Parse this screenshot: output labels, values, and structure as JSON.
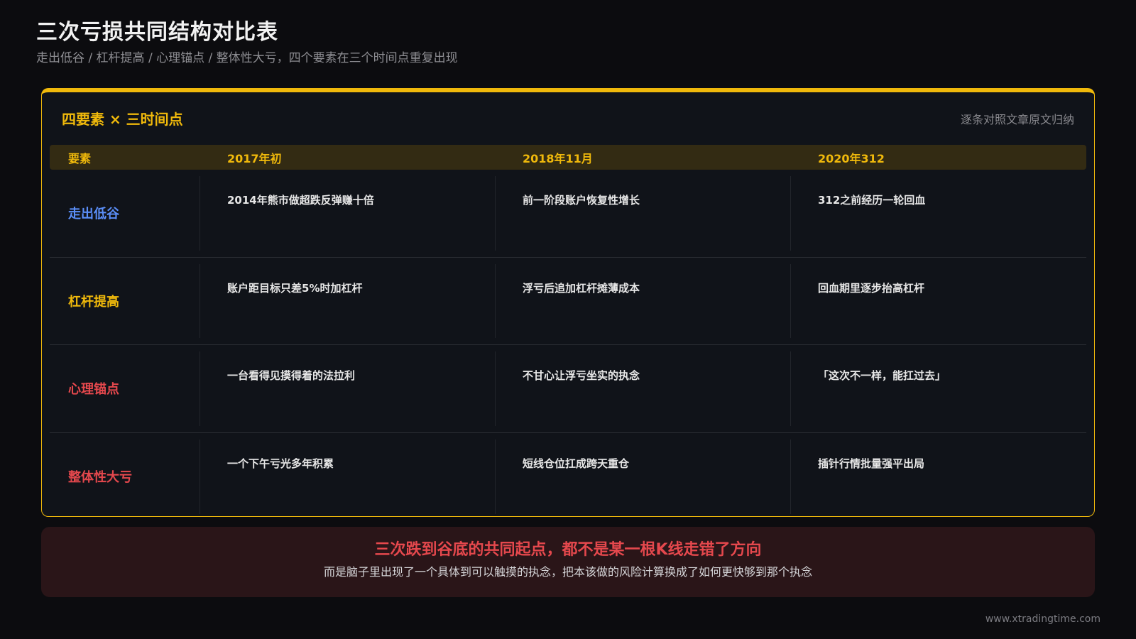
{
  "header": {
    "title": "三次亏损共同结构对比表",
    "subtitle": "走出低谷 / 杠杆提高 / 心理锚点 / 整体性大亏，四个要素在三个时间点重复出现"
  },
  "card": {
    "title": "四要素 × 三时间点",
    "note": "逐条对照文章原文归纳",
    "columns": [
      "要素",
      "2017年初",
      "2018年11月",
      "2020年312"
    ],
    "rows": [
      {
        "label": "走出低谷",
        "color": "#5b8ff9",
        "cells": [
          "2014年熊市做超跌反弹赚十倍",
          "前一阶段账户恢复性增长",
          "312之前经历一轮回血"
        ]
      },
      {
        "label": "杠杆提高",
        "color": "#f0b90b",
        "cells": [
          "账户距目标只差5%时加杠杆",
          "浮亏后追加杠杆摊薄成本",
          "回血期里逐步抬高杠杆"
        ]
      },
      {
        "label": "心理锚点",
        "color": "#e5484d",
        "cells": [
          "一台看得见摸得着的法拉利",
          "不甘心让浮亏坐实的执念",
          "「这次不一样，能扛过去」"
        ]
      },
      {
        "label": "整体性大亏",
        "color": "#e5484d",
        "cells": [
          "一个下午亏光多年积累",
          "短线仓位扛成跨天重仓",
          "插针行情批量强平出局"
        ]
      }
    ]
  },
  "banner": {
    "title": "三次跌到谷底的共同起点，都不是某一根K线走错了方向",
    "body": "而是脑子里出现了一个具体到可以触摸的执念，把本该做的风险计算换成了如何更快够到那个执念"
  },
  "footer": {
    "url": "www.xtradingtime.com"
  },
  "colors": {
    "accent": "#f0b90b",
    "blue": "#5b8ff9",
    "red": "#e5484d",
    "background": "#0c0c0f"
  }
}
